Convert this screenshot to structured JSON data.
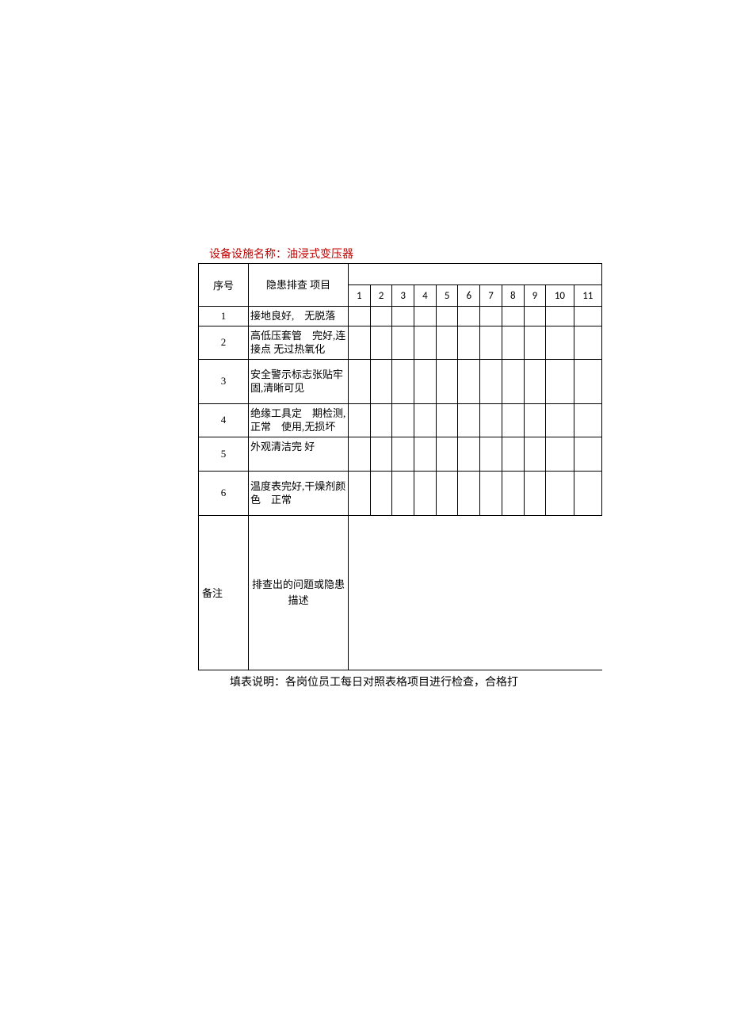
{
  "title": "设备设施名称：油浸式变压器",
  "headers": {
    "seq": "序号",
    "item": "隐患排查 项目"
  },
  "days": [
    "1",
    "2",
    "3",
    "4",
    "5",
    "6",
    "7",
    "8",
    "9",
    "10",
    "11"
  ],
  "rows": [
    {
      "seq": "1",
      "item": "接地良好,　无脱落"
    },
    {
      "seq": "2",
      "item": "高低压套管　完好,连接点 无过热氧化"
    },
    {
      "seq": "3",
      "item_center": "安全警示标志张贴牢固,清晰可见"
    },
    {
      "seq": "4",
      "item": "绝缘工具定　期检测,正常　使用,无损坏"
    },
    {
      "seq": "5",
      "item": "外观清洁完 好"
    },
    {
      "seq": "6",
      "item_center": "温度表完好,干燥剂颜色　正常"
    }
  ],
  "note": {
    "label": "备注",
    "desc": "排查出的问题或隐患描述"
  },
  "footnote": "填表说明：各岗位员工每日对照表格项目进行检查，合格打"
}
